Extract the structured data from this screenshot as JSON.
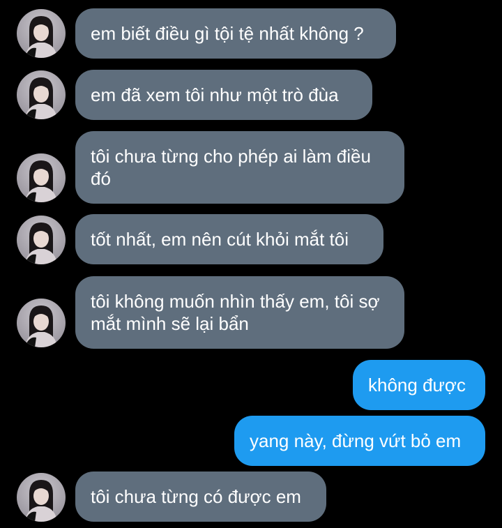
{
  "conversation": {
    "messages": [
      {
        "side": "in",
        "text": "em biết điều gì tội tệ nhất không ?"
      },
      {
        "side": "in",
        "text": "em đã xem tôi như một trò đùa"
      },
      {
        "side": "in",
        "text": "tôi chưa từng cho phép ai làm điều đó"
      },
      {
        "side": "in",
        "text": "tốt nhất, em nên cút khỏi mắt tôi"
      },
      {
        "side": "in",
        "text": "tôi không muốn nhìn thấy em, tôi sợ mắt mình sẽ lại bẩn"
      },
      {
        "side": "out",
        "text": "không được"
      },
      {
        "side": "out",
        "text": "yang này, đừng vứt bỏ em"
      },
      {
        "side": "in",
        "text": "tôi chưa từng có được em"
      }
    ]
  },
  "colors": {
    "background": "#000000",
    "incoming_bubble": "#5f6e7d",
    "outgoing_bubble": "#1e9bf0",
    "text": "#ffffff"
  },
  "icons": {
    "avatar": "contact-avatar-photo"
  }
}
